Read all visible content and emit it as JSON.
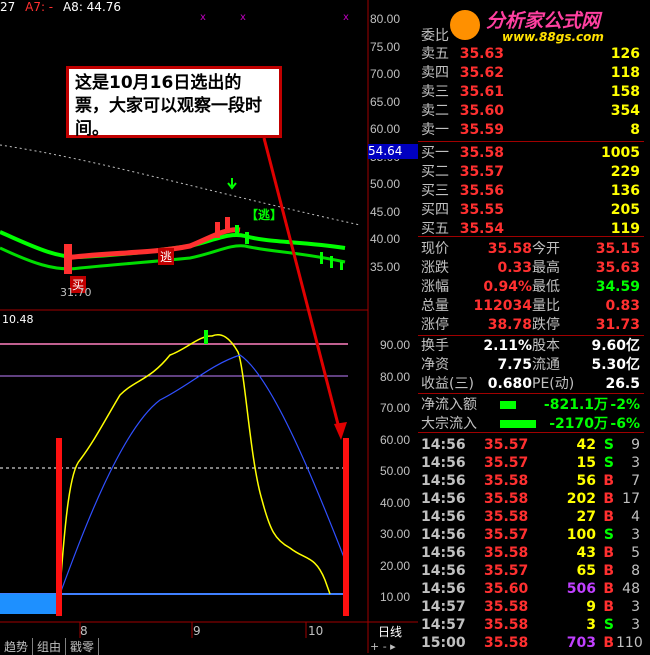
{
  "header": {
    "ma_left": "27",
    "ma_a7": "A7: -",
    "ma_a8": "A8: 44.76"
  },
  "logo": {
    "title": "分析家公式网",
    "url": "www.88gs.com"
  },
  "callout": {
    "text": "这是10月16日选出的票，大家可以观察一段时间。"
  },
  "price_axis": [
    "80.00",
    "75.00",
    "70.00",
    "65.00",
    "60.00",
    "55.00",
    "50.00",
    "45.00",
    "40.00",
    "35.00"
  ],
  "current_price_tag": "54.64",
  "chart_labels": {
    "escape_top": "【逃】",
    "escape_mid": "逃",
    "buy_left": "买",
    "low_price": "31.70",
    "indicator_value": "10.48"
  },
  "indicator_axis": [
    "90.00",
    "80.00",
    "70.00",
    "60.00",
    "50.00",
    "40.00",
    "30.00",
    "20.00",
    "10.00"
  ],
  "x_axis": [
    "8",
    "9",
    "10"
  ],
  "period_label": "日线",
  "bottom_tabs": [
    "趋势",
    "组由",
    "戳零"
  ],
  "order_book": {
    "header": "委比",
    "asks": [
      {
        "label": "卖五",
        "price": "35.63",
        "vol": "126"
      },
      {
        "label": "卖四",
        "price": "35.62",
        "vol": "118"
      },
      {
        "label": "卖三",
        "price": "35.61",
        "vol": "158"
      },
      {
        "label": "卖二",
        "price": "35.60",
        "vol": "354"
      },
      {
        "label": "卖一",
        "price": "35.59",
        "vol": "8"
      }
    ],
    "bids": [
      {
        "label": "买一",
        "price": "35.58",
        "vol": "1005"
      },
      {
        "label": "买二",
        "price": "35.57",
        "vol": "229"
      },
      {
        "label": "买三",
        "price": "35.56",
        "vol": "136"
      },
      {
        "label": "买四",
        "price": "35.55",
        "vol": "205"
      },
      {
        "label": "买五",
        "price": "35.54",
        "vol": "119"
      }
    ]
  },
  "quote": [
    {
      "l1": "现价",
      "v1": "35.58",
      "l2": "今开",
      "v2": "35.15"
    },
    {
      "l1": "涨跌",
      "v1": "0.33",
      "l2": "最高",
      "v2": "35.63"
    },
    {
      "l1": "涨幅",
      "v1": "0.94%",
      "l2": "最低",
      "v2": "34.59"
    },
    {
      "l1": "总量",
      "v1": "112034",
      "l2": "量比",
      "v2": "0.83"
    },
    {
      "l1": "涨停",
      "v1": "38.78",
      "l2": "跌停",
      "v2": "31.73"
    }
  ],
  "stats": [
    {
      "l1": "换手",
      "v1": "2.11%",
      "l2": "股本",
      "v2": "9.60亿"
    },
    {
      "l1": "净资",
      "v1": "7.75",
      "l2": "流通",
      "v2": "5.30亿"
    },
    {
      "l1": "收益(三)",
      "v1": "0.680",
      "l2": "PE(动)",
      "v2": "26.5"
    }
  ],
  "flows": [
    {
      "label": "净流入额",
      "value": "-821.1万",
      "pct": "-2%"
    },
    {
      "label": "大宗流入",
      "value": "-2170万",
      "pct": "-6%"
    }
  ],
  "ticks": [
    {
      "time": "14:56",
      "price": "35.57",
      "vol": "42",
      "side": "S",
      "cnt": "9"
    },
    {
      "time": "14:56",
      "price": "35.57",
      "vol": "15",
      "side": "S",
      "cnt": "3"
    },
    {
      "time": "14:56",
      "price": "35.58",
      "vol": "56",
      "side": "B",
      "cnt": "7"
    },
    {
      "time": "14:56",
      "price": "35.58",
      "vol": "202",
      "side": "B",
      "cnt": "17"
    },
    {
      "time": "14:56",
      "price": "35.58",
      "vol": "27",
      "side": "B",
      "cnt": "4"
    },
    {
      "time": "14:56",
      "price": "35.57",
      "vol": "100",
      "side": "S",
      "cnt": "3"
    },
    {
      "time": "14:56",
      "price": "35.58",
      "vol": "43",
      "side": "B",
      "cnt": "5"
    },
    {
      "time": "14:56",
      "price": "35.57",
      "vol": "65",
      "side": "B",
      "cnt": "8"
    },
    {
      "time": "14:56",
      "price": "35.60",
      "vol": "506",
      "side": "B",
      "cnt": "48"
    },
    {
      "time": "14:57",
      "price": "35.58",
      "vol": "9",
      "side": "B",
      "cnt": "3"
    },
    {
      "time": "14:57",
      "price": "35.58",
      "vol": "3",
      "side": "S",
      "cnt": "3"
    },
    {
      "time": "15:00",
      "price": "35.58",
      "vol": "703",
      "side": "B",
      "cnt": "110"
    }
  ],
  "colors": {
    "up": "#ff3030",
    "down": "#00ff00",
    "volume": "#ffff00",
    "buy": "#ff3030",
    "sell": "#00ff00",
    "grid": "#a00000"
  }
}
